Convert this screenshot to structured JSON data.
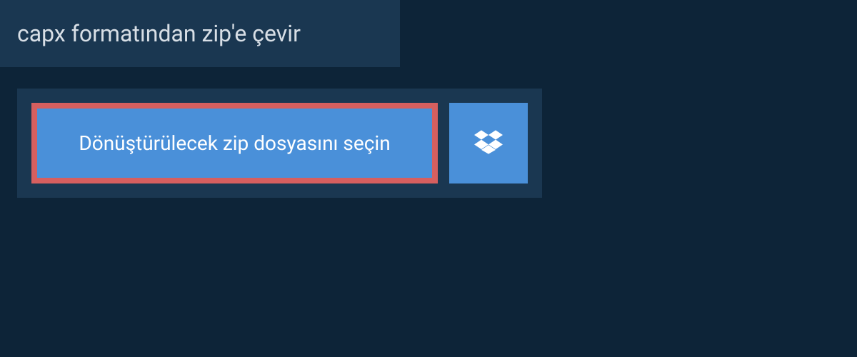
{
  "header": {
    "title": "capx formatından zip'e çevir"
  },
  "upload": {
    "select_file_label": "Dönüştürülecek zip dosyasını seçin"
  },
  "colors": {
    "background": "#0d2438",
    "panel": "#1a3751",
    "button": "#4a90d9",
    "highlight_border": "#d65f5f",
    "text_light": "#ffffff",
    "text_muted": "#d8dfe6"
  }
}
